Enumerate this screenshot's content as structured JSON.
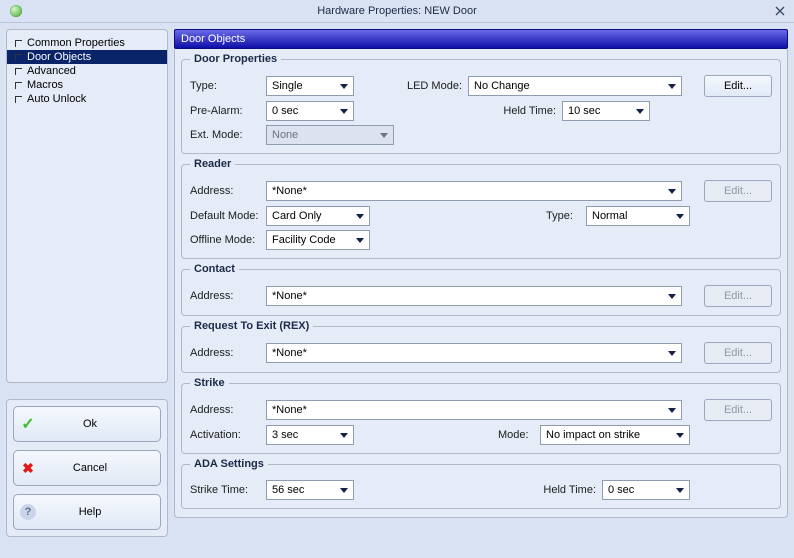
{
  "window": {
    "title": "Hardware Properties: NEW Door"
  },
  "nav": {
    "items": [
      {
        "label": "Common Properties",
        "selected": false
      },
      {
        "label": "Door Objects",
        "selected": true
      },
      {
        "label": "Advanced",
        "selected": false
      },
      {
        "label": "Macros",
        "selected": false
      },
      {
        "label": "Auto Unlock",
        "selected": false
      }
    ]
  },
  "buttons": {
    "ok": "Ok",
    "cancel": "Cancel",
    "help": "Help",
    "edit": "Edit..."
  },
  "section_title": "Door Objects",
  "groups": {
    "door_properties": {
      "legend": "Door Properties",
      "type_label": "Type:",
      "type_value": "Single",
      "led_label": "LED Mode:",
      "led_value": "No Change",
      "prealarm_label": "Pre-Alarm:",
      "prealarm_value": "0 sec",
      "held_label": "Held Time:",
      "held_value": "10 sec",
      "ext_label": "Ext. Mode:",
      "ext_value": "None"
    },
    "reader": {
      "legend": "Reader",
      "address_label": "Address:",
      "address_value": "*None*",
      "default_label": "Default Mode:",
      "default_value": "Card Only",
      "type_label": "Type:",
      "type_value": "Normal",
      "offline_label": "Offline Mode:",
      "offline_value": "Facility Code"
    },
    "contact": {
      "legend": "Contact",
      "address_label": "Address:",
      "address_value": "*None*"
    },
    "rex": {
      "legend": "Request To Exit (REX)",
      "address_label": "Address:",
      "address_value": "*None*"
    },
    "strike": {
      "legend": "Strike",
      "address_label": "Address:",
      "address_value": "*None*",
      "activation_label": "Activation:",
      "activation_value": "3 sec",
      "mode_label": "Mode:",
      "mode_value": "No impact on strike"
    },
    "ada": {
      "legend": "ADA Settings",
      "strike_label": "Strike Time:",
      "strike_value": "56 sec",
      "held_label": "Held Time:",
      "held_value": "0 sec"
    }
  }
}
